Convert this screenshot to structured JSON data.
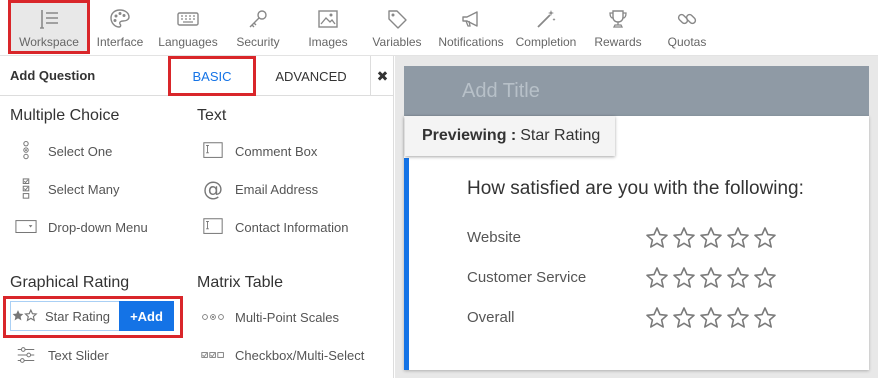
{
  "toolbar": {
    "items": [
      {
        "label": "Workspace",
        "icon": "workspace-icon"
      },
      {
        "label": "Interface",
        "icon": "palette-icon"
      },
      {
        "label": "Languages",
        "icon": "keyboard-icon"
      },
      {
        "label": "Security",
        "icon": "key-icon"
      },
      {
        "label": "Images",
        "icon": "image-icon"
      },
      {
        "label": "Variables",
        "icon": "tag-icon"
      },
      {
        "label": "Notifications",
        "icon": "megaphone-icon"
      },
      {
        "label": "Completion",
        "icon": "magic-wand-icon"
      },
      {
        "label": "Rewards",
        "icon": "trophy-icon"
      },
      {
        "label": "Quotas",
        "icon": "link-icon"
      }
    ],
    "active": "Workspace"
  },
  "panel": {
    "title": "Add Question",
    "tabs": {
      "basic": "BASIC",
      "advanced": "ADVANCED",
      "active": "BASIC"
    },
    "close": "✖",
    "sections": {
      "multiple_choice": {
        "title": "Multiple Choice",
        "items": [
          {
            "label": "Select One",
            "icon": "radio-list-icon"
          },
          {
            "label": "Select Many",
            "icon": "checkbox-list-icon"
          },
          {
            "label": "Drop-down Menu",
            "icon": "dropdown-icon"
          }
        ]
      },
      "text": {
        "title": "Text",
        "items": [
          {
            "label": "Comment Box",
            "icon": "text-box-icon"
          },
          {
            "label": "Email Address",
            "icon": "at-icon"
          },
          {
            "label": "Contact Information",
            "icon": "text-box-icon"
          }
        ]
      },
      "graphical_rating": {
        "title": "Graphical Rating",
        "items": [
          {
            "label": "Star Rating",
            "icon": "stars-icon"
          },
          {
            "label": "Text Slider",
            "icon": "slider-icon"
          }
        ],
        "add_label": "+Add"
      },
      "matrix_table": {
        "title": "Matrix Table",
        "items": [
          {
            "label": "Multi-Point Scales",
            "icon": "multi-point-icon"
          },
          {
            "label": "Checkbox/Multi-Select",
            "icon": "checkbox-multi-icon"
          }
        ]
      }
    }
  },
  "preview": {
    "title_placeholder": "Add Title",
    "previewing_label": "Previewing :",
    "previewing_value": "Star Rating",
    "question": "How satisfied are you with the following:",
    "rows": [
      "Website",
      "Customer Service",
      "Overall"
    ],
    "stars_per_row": 5
  },
  "colors": {
    "accent": "#1473e6",
    "highlight": "#d9262a",
    "title_bar": "#8f9aa5",
    "star_outline": "#7a7a7a"
  }
}
